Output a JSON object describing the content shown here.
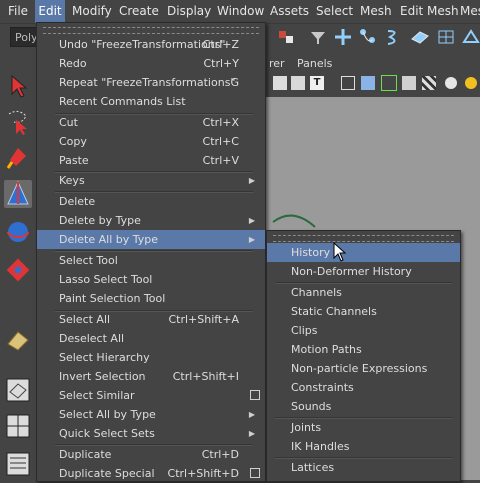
{
  "menubar": {
    "items": [
      "File",
      "Edit",
      "Modify",
      "Create",
      "Display",
      "Window",
      "Assets",
      "Select",
      "Mesh",
      "Edit Mesh",
      "Mes"
    ],
    "active": "Edit"
  },
  "toolbar": {
    "mode_select": "Poly"
  },
  "panel": {
    "menu_partial": "rer",
    "panels_label": "Panels"
  },
  "edit_menu": {
    "items": [
      {
        "label": "Undo \"FreezeTransformations\"",
        "shortcut": "Ctrl+Z"
      },
      {
        "label": "Redo",
        "shortcut": "Ctrl+Y"
      },
      {
        "label": "Repeat \"FreezeTransformations\"",
        "shortcut": "G"
      },
      {
        "label": "Recent Commands List",
        "shortcut": ""
      },
      {
        "label": "Cut",
        "shortcut": "Ctrl+X"
      },
      {
        "label": "Copy",
        "shortcut": "Ctrl+C"
      },
      {
        "label": "Paste",
        "shortcut": "Ctrl+V"
      },
      {
        "label": "Keys",
        "shortcut": ""
      },
      {
        "label": "Delete",
        "shortcut": ""
      },
      {
        "label": "Delete by Type",
        "shortcut": ""
      },
      {
        "label": "Delete All by Type",
        "shortcut": ""
      },
      {
        "label": "Select Tool",
        "shortcut": ""
      },
      {
        "label": "Lasso Select Tool",
        "shortcut": ""
      },
      {
        "label": "Paint Selection Tool",
        "shortcut": ""
      },
      {
        "label": "Select All",
        "shortcut": "Ctrl+Shift+A"
      },
      {
        "label": "Deselect All",
        "shortcut": ""
      },
      {
        "label": "Select Hierarchy",
        "shortcut": ""
      },
      {
        "label": "Invert Selection",
        "shortcut": "Ctrl+Shift+I"
      },
      {
        "label": "Select Similar",
        "shortcut": ""
      },
      {
        "label": "Select All by Type",
        "shortcut": ""
      },
      {
        "label": "Quick Select Sets",
        "shortcut": ""
      },
      {
        "label": "Duplicate",
        "shortcut": "Ctrl+D"
      },
      {
        "label": "Duplicate Special",
        "shortcut": "Ctrl+Shift+D"
      }
    ],
    "highlighted": "Delete All by Type"
  },
  "sub_menu": {
    "items": [
      "History",
      "Non-Deformer History",
      "Channels",
      "Static Channels",
      "Clips",
      "Motion Paths",
      "Non-particle Expressions",
      "Constraints",
      "Sounds",
      "Joints",
      "IK Handles",
      "Lattices"
    ],
    "highlighted": "History"
  },
  "colors": {
    "menu_bg": "#444444",
    "highlight": "#5b79a8",
    "viewport": "#9a9a9a",
    "text": "#dedede"
  }
}
